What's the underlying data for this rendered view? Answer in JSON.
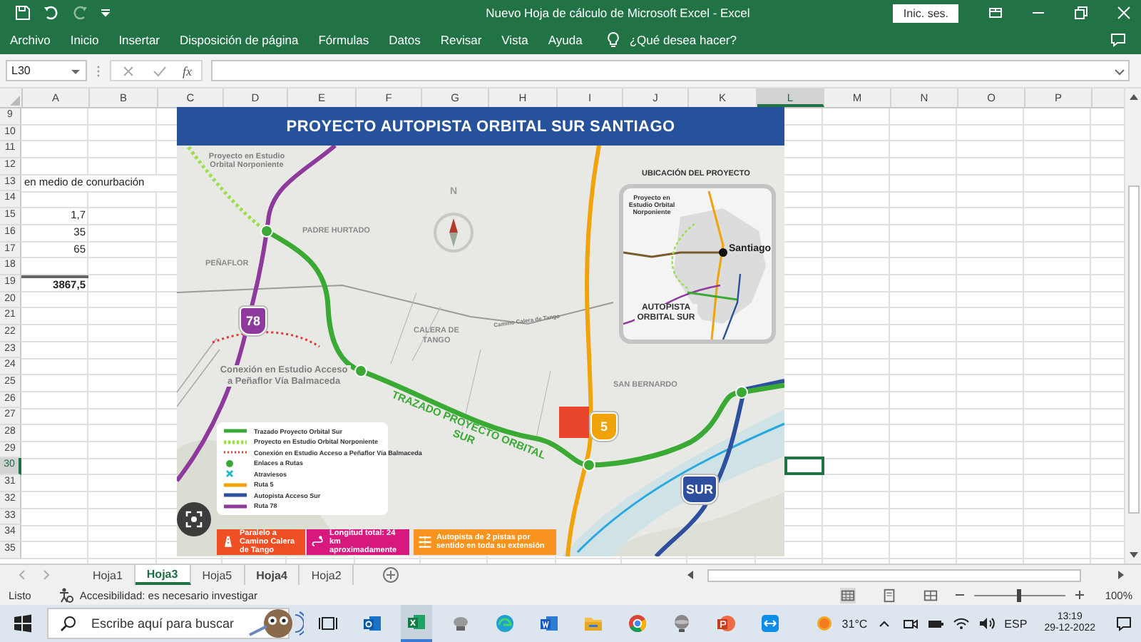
{
  "window": {
    "title": "Nuevo Hoja de cálculo de Microsoft Excel  -  Excel",
    "sign_in": "Inic. ses."
  },
  "ribbon_tabs": [
    "Archivo",
    "Inicio",
    "Insertar",
    "Disposición de página",
    "Fórmulas",
    "Datos",
    "Revisar",
    "Vista",
    "Ayuda"
  ],
  "tell_me": "¿Qué desea hacer?",
  "formula_bar": {
    "name_box": "L30",
    "function_label": "fx"
  },
  "sheet": {
    "columns": [
      {
        "label": "A",
        "selected": false
      },
      {
        "label": "B",
        "selected": false
      },
      {
        "label": "C",
        "selected": false
      },
      {
        "label": "D",
        "selected": false
      },
      {
        "label": "E",
        "selected": false
      },
      {
        "label": "F",
        "selected": false
      },
      {
        "label": "G",
        "selected": false
      },
      {
        "label": "H",
        "selected": false
      },
      {
        "label": "I",
        "selected": false
      },
      {
        "label": "J",
        "selected": false
      },
      {
        "label": "K",
        "selected": false
      },
      {
        "label": "L",
        "selected": true
      },
      {
        "label": "M",
        "selected": false
      },
      {
        "label": "N",
        "selected": false
      },
      {
        "label": "O",
        "selected": false
      },
      {
        "label": "P",
        "selected": false
      }
    ],
    "rows": [
      {
        "label": "9",
        "selected": false
      },
      {
        "label": "10",
        "selected": false
      },
      {
        "label": "11",
        "selected": false
      },
      {
        "label": "12",
        "selected": false
      },
      {
        "label": "13",
        "selected": false,
        "cells": [
          {
            "value": "en medio de conurbación",
            "kind": "text"
          }
        ]
      },
      {
        "label": "14",
        "selected": false
      },
      {
        "label": "15",
        "selected": false,
        "cells": [
          {
            "value": "1,7",
            "kind": "number"
          }
        ]
      },
      {
        "label": "16",
        "selected": false,
        "cells": [
          {
            "value": "35",
            "kind": "number"
          }
        ]
      },
      {
        "label": "17",
        "selected": false,
        "cells": [
          {
            "value": "65",
            "kind": "number"
          }
        ]
      },
      {
        "label": "18",
        "selected": false
      },
      {
        "label": "19",
        "selected": false,
        "cells": [
          {
            "value": "3867,5",
            "kind": "total"
          }
        ]
      },
      {
        "label": "20",
        "selected": false
      },
      {
        "label": "21",
        "selected": false
      },
      {
        "label": "22",
        "selected": false
      },
      {
        "label": "23",
        "selected": false
      },
      {
        "label": "24",
        "selected": false
      },
      {
        "label": "25",
        "selected": false
      },
      {
        "label": "26",
        "selected": false
      },
      {
        "label": "27",
        "selected": false
      },
      {
        "label": "28",
        "selected": false
      },
      {
        "label": "29",
        "selected": false
      },
      {
        "label": "30",
        "selected": true
      },
      {
        "label": "31",
        "selected": false
      },
      {
        "label": "32",
        "selected": false
      },
      {
        "label": "33",
        "selected": false
      },
      {
        "label": "34",
        "selected": false
      },
      {
        "label": "35",
        "selected": false
      }
    ]
  },
  "picture": {
    "title": "PROYECTO AUTOPISTA ORBITAL SUR SANTIAGO",
    "labels": [
      "Proyecto en Estudio Orbital Norponiente",
      "PADRE HURTADO",
      "PEÑAFLOR",
      "N",
      "CALERA DE TANGO",
      "Camino Calera de Tango",
      "Conexión en Estudio Acceso a Peñaflor Vía Balmaceda",
      "TRAZADO PROYECTO ORBITAL SUR",
      "SAN BERNARDO"
    ],
    "shields": [
      {
        "text": "78",
        "color": "#8e3a9d"
      },
      {
        "text": "5",
        "color": "#f0a30a"
      },
      {
        "text": "SUR",
        "color": "#2d4f9e"
      }
    ],
    "inset": {
      "title": "UBICACIÓN DEL PROYECTO",
      "labels": [
        "Proyecto en Estudio Orbital Norponiente",
        "Santiago",
        "AUTOPISTA ORBITAL SUR"
      ]
    },
    "legend": [
      {
        "label": "Trazado Proyecto Orbital Sur",
        "kind": "line",
        "color": "#3aaa35"
      },
      {
        "label": "Proyecto en Estudio Orbital Norponiente",
        "kind": "dashed",
        "color": "#9be04a"
      },
      {
        "label": "Conexión en Estudio Acceso a Peñaflor Vía Balmaceda",
        "kind": "dotted",
        "color": "#e53935"
      },
      {
        "label": "Enlaces a Rutas",
        "kind": "dot",
        "color": "#3aaa35"
      },
      {
        "label": "Atraviesos",
        "kind": "cross",
        "color": "#1fb5c9"
      },
      {
        "label": "Ruta 5",
        "kind": "line",
        "color": "#f0a30a"
      },
      {
        "label": "Autopista Acceso Sur",
        "kind": "line",
        "color": "#2d4f9e"
      },
      {
        "label": "Ruta 78",
        "kind": "line",
        "color": "#8e3a9d"
      }
    ],
    "info_boxes": [
      {
        "text": "Paralelo a Camino Calera de Tango",
        "kind": "road",
        "color": "#f04e23"
      },
      {
        "text": "Longitud total: 24 km aproximadamente",
        "kind": "pin",
        "color": "#d6187f"
      },
      {
        "text": "Autopista de 2 pistas por sentido en toda su extensión",
        "kind": "lanes",
        "color": "#f7931e"
      }
    ]
  },
  "sheet_tabs": [
    {
      "label": "Hoja1",
      "selected": false,
      "bold": false
    },
    {
      "label": "Hoja3",
      "selected": true,
      "bold": true
    },
    {
      "label": "Hoja5",
      "selected": false,
      "bold": false
    },
    {
      "label": "Hoja4",
      "selected": false,
      "bold": true
    },
    {
      "label": "Hoja2",
      "selected": false,
      "bold": false
    }
  ],
  "status_bar": {
    "status": "Listo",
    "accessibility": "Accesibilidad: es necesario investigar",
    "zoom": {
      "level": 0.5
    },
    "zoom_label": "100%"
  },
  "taskbar": {
    "search_placeholder": "Escribe aquí para buscar",
    "apps": [
      {
        "kind": "taskview",
        "active": false
      },
      {
        "kind": "mail",
        "active": false
      },
      {
        "kind": "sheet",
        "active": true
      },
      {
        "kind": "dish",
        "active": false
      },
      {
        "kind": "edge",
        "active": false
      },
      {
        "kind": "doc",
        "active": false
      },
      {
        "kind": "folder",
        "active": false
      },
      {
        "kind": "chrome",
        "active": false
      },
      {
        "kind": "sphere",
        "active": false
      },
      {
        "kind": "slides",
        "active": false
      },
      {
        "kind": "remote",
        "active": false
      }
    ],
    "weather": "31°C",
    "language": "ESP",
    "time": "13:19",
    "date": "29-12-2022"
  }
}
